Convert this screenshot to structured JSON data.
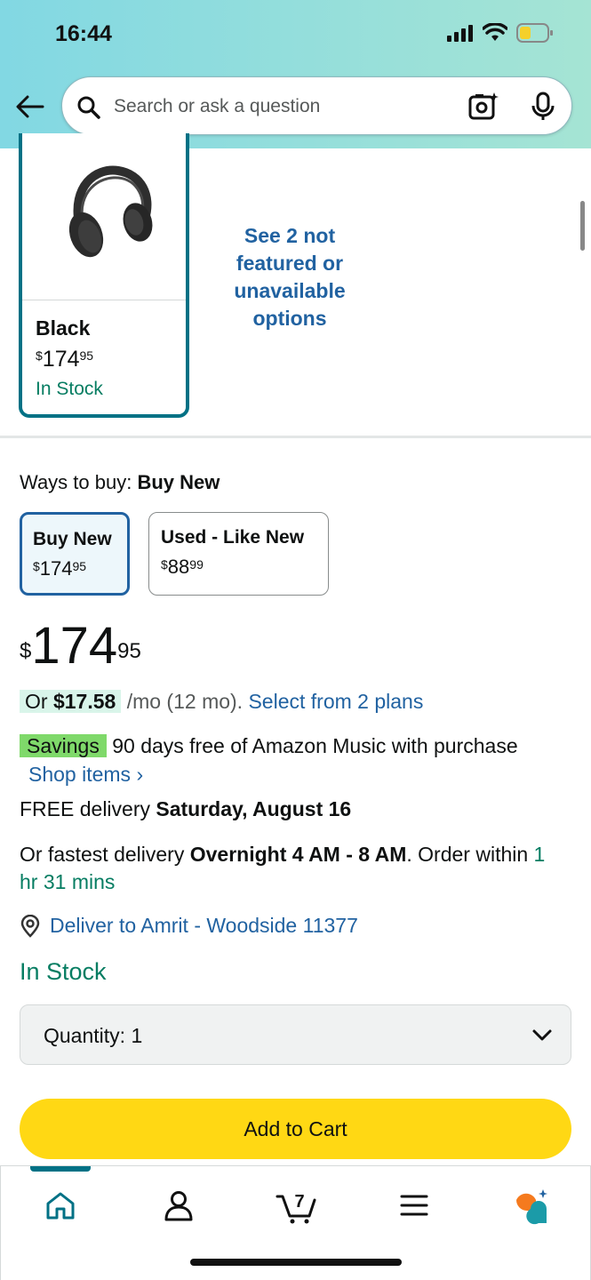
{
  "status_bar": {
    "time": "16:44"
  },
  "search": {
    "placeholder": "Search or ask a question"
  },
  "variant": {
    "name": "Black",
    "price_dollars": "174",
    "price_cents": "95",
    "stock": "In Stock"
  },
  "see_options": {
    "label": "See 2 not featured or unavailable options"
  },
  "ways_to_buy": {
    "label": "Ways to buy:",
    "selected": "Buy New",
    "options": [
      {
        "title": "Buy New",
        "price_dollars": "174",
        "price_cents": "95"
      },
      {
        "title": "Used - Like New",
        "price_dollars": "88",
        "price_cents": "99"
      }
    ]
  },
  "price": {
    "currency": "$",
    "dollars": "174",
    "cents": "95"
  },
  "financing": {
    "prefix": "Or",
    "amount": "$17.58",
    "term": "/mo (12 mo).",
    "link": "Select from 2 plans"
  },
  "savings": {
    "badge": "Savings",
    "text": "90 days free of Amazon Music with purchase",
    "link": "Shop items ›"
  },
  "delivery": {
    "free_prefix": "FREE delivery",
    "free_date": "Saturday, August 16",
    "fast_prefix": "Or fastest delivery",
    "fast_window": "Overnight 4 AM - 8 AM",
    "order_within_prefix": ". Order within",
    "order_within_time": "1 hr 31 mins",
    "deliver_to": "Deliver to Amrit - Woodside 11377"
  },
  "stock_status": "In Stock",
  "quantity": {
    "label": "Quantity:",
    "value": "1"
  },
  "add_to_cart": {
    "label": "Add to Cart"
  },
  "bottom_nav": {
    "items": [
      {
        "icon": "home-icon"
      },
      {
        "icon": "account-icon"
      },
      {
        "icon": "cart-icon",
        "count": "7"
      },
      {
        "icon": "menu-icon"
      },
      {
        "icon": "rufus-icon"
      }
    ]
  },
  "colors": {
    "header_gradient_start": "#82d8e3",
    "header_gradient_end": "#a5e4d4",
    "link": "#2162a1",
    "in_stock_green": "#067d62",
    "selected_border": "#2162a1",
    "add_to_cart_yellow": "#ffd814",
    "savings_badge": "#7fd96a"
  }
}
